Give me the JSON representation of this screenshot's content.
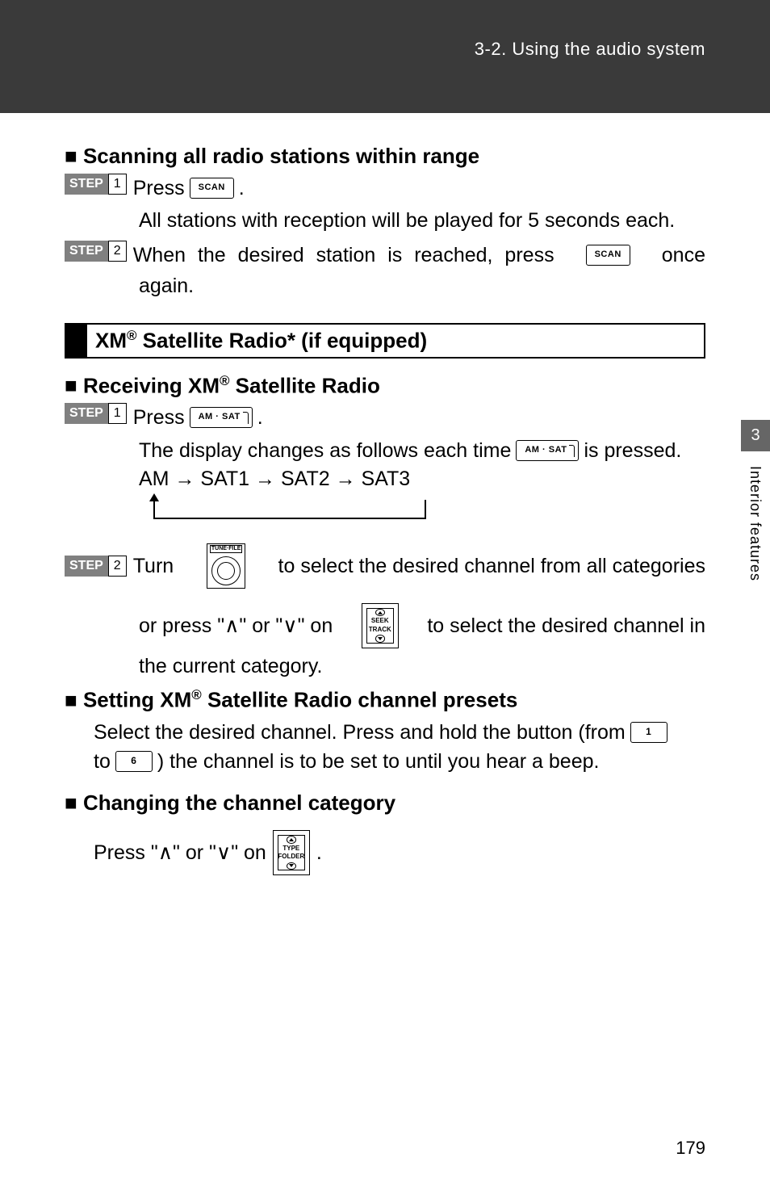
{
  "header": {
    "breadcrumb": "3-2. Using the audio system"
  },
  "scanning": {
    "heading": "Scanning all radio stations within range",
    "step_label": "STEP",
    "step1_num": "1",
    "step1_line": "Press",
    "step1_desc": "All stations with reception will be played for 5 seconds each.",
    "step2_num": "2",
    "step2_a": "When the desired station is reached, press",
    "step2_b": "once again."
  },
  "xm_section_title_a": "XM",
  "xm_section_title_b": " Satellite Radio* (if equipped)",
  "receiving": {
    "heading_a": "Receiving XM",
    "heading_b": " Satellite Radio",
    "step1_num": "1",
    "step1_line": "Press",
    "step1_dot": ".",
    "step1_desc_a": "The display changes as follows each time ",
    "step1_desc_b": " is pressed.",
    "sequence": "AM → SAT1 → SAT2 → SAT3",
    "step2_num": "2",
    "step2_a": "Turn",
    "step2_b": "to select the desired channel from all categories",
    "step2_c": "or press \"∧\" or \"∨\" on",
    "step2_d": "to select the desired channel in",
    "step2_e": "the current category."
  },
  "presets": {
    "heading_a": "Setting XM",
    "heading_b": " Satellite Radio channel presets",
    "line_a": "Select the desired channel. Press and hold the button (from ",
    "line_b": "to ",
    "line_c": " ) the channel is to be set to until you hear a beep."
  },
  "category": {
    "heading": "Changing the channel category",
    "line_a": "Press \"∧\" or \"∨\" on",
    "line_dot": "."
  },
  "keys": {
    "scan": "SCAN",
    "amsat": "AM · SAT",
    "tunefile": "TUNE·FILE",
    "seek1": "SEEK",
    "seek2": "TRACK",
    "type1": "TYPE",
    "type2": "FOLDER",
    "one": "1",
    "six": "6"
  },
  "sidetab": {
    "num": "3",
    "label": "Interior features"
  },
  "sup_r": "®",
  "page_number": "179"
}
